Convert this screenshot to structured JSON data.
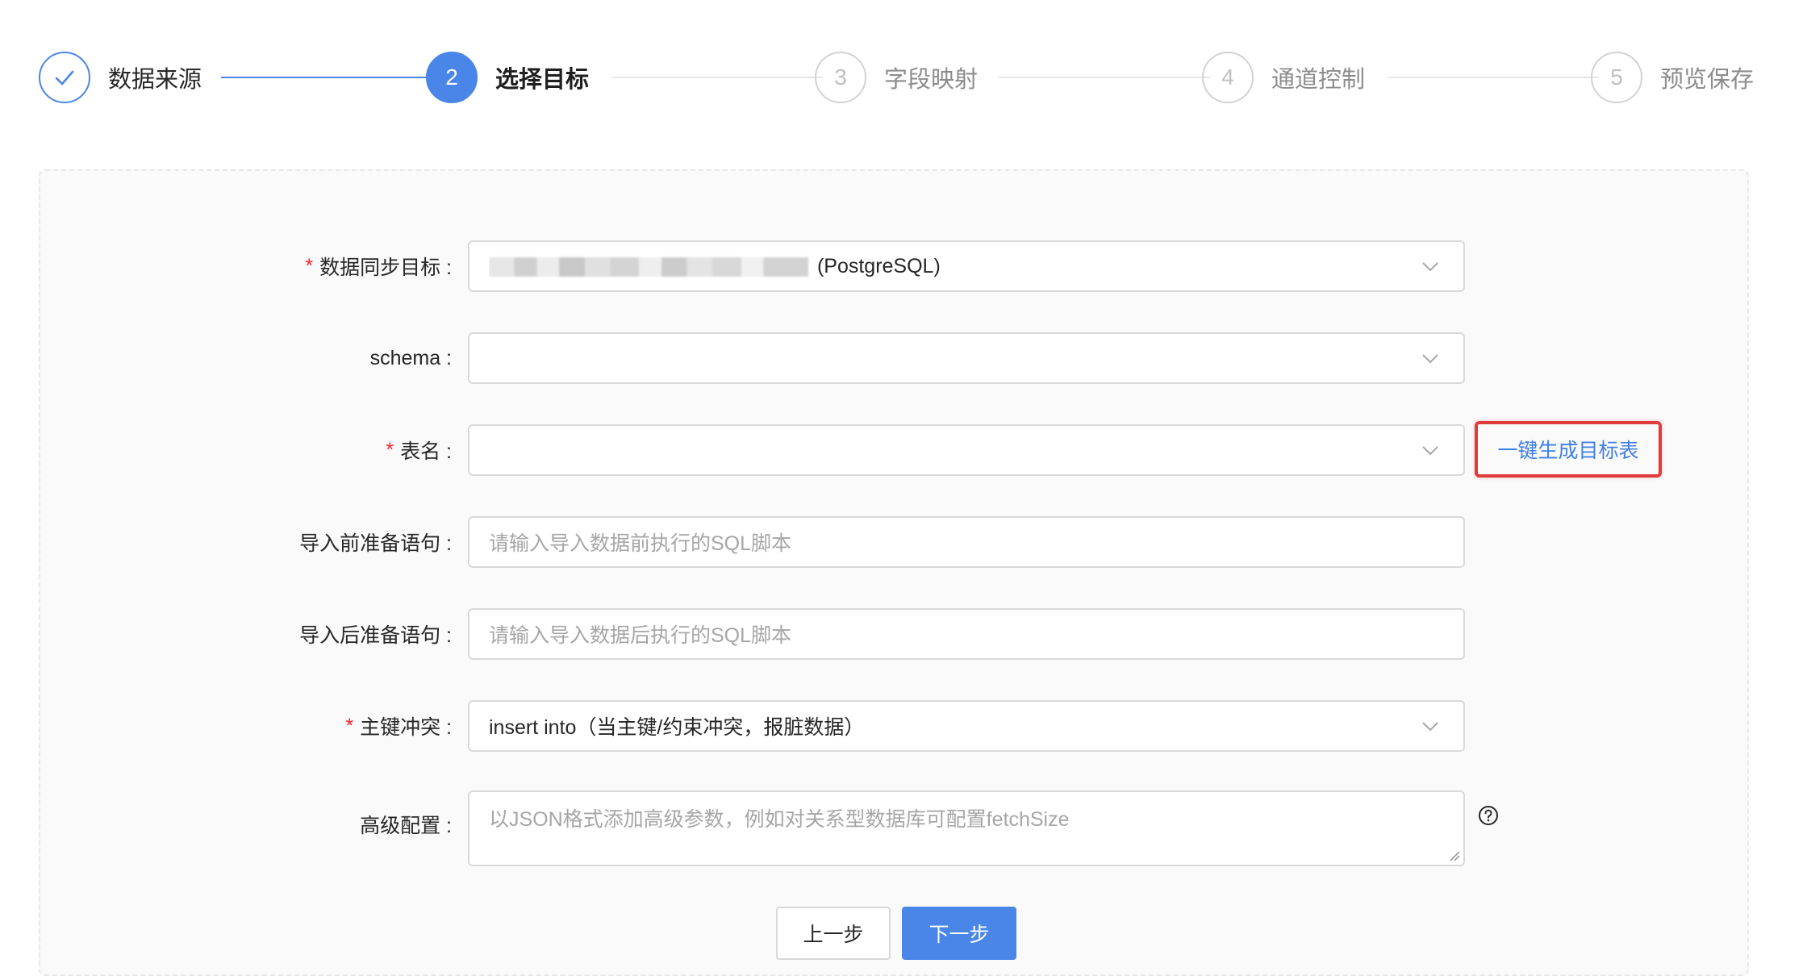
{
  "steps": [
    {
      "number": "✓",
      "label": "数据来源",
      "status": "finished"
    },
    {
      "number": "2",
      "label": "选择目标",
      "status": "active"
    },
    {
      "number": "3",
      "label": "字段映射",
      "status": "wait"
    },
    {
      "number": "4",
      "label": "通道控制",
      "status": "wait"
    },
    {
      "number": "5",
      "label": "预览保存",
      "status": "wait"
    }
  ],
  "form": {
    "target": {
      "label": "数据同步目标 :",
      "required_mark": "*",
      "value_suffix": "(PostgreSQL)",
      "value_obscured": true
    },
    "schema": {
      "label": "schema :",
      "value": ""
    },
    "table": {
      "label": "表名 :",
      "required_mark": "*",
      "value": "",
      "action_label": "一键生成目标表"
    },
    "pre_sql": {
      "label": "导入前准备语句 :",
      "placeholder": "请输入导入数据前执行的SQL脚本"
    },
    "post_sql": {
      "label": "导入后准备语句 :",
      "placeholder": "请输入导入数据后执行的SQL脚本"
    },
    "conflict": {
      "label": "主键冲突 :",
      "required_mark": "*",
      "value": "insert into（当主键/约束冲突，报脏数据）"
    },
    "advanced": {
      "label": "高级配置 :",
      "placeholder": "以JSON格式添加高级参数，例如对关系型数据库可配置fetchSize"
    }
  },
  "buttons": {
    "prev": "上一步",
    "next": "下一步"
  },
  "colors": {
    "primary": "#4a86e8",
    "required": "#f5222d",
    "highlight_box": "#e03b3b"
  }
}
